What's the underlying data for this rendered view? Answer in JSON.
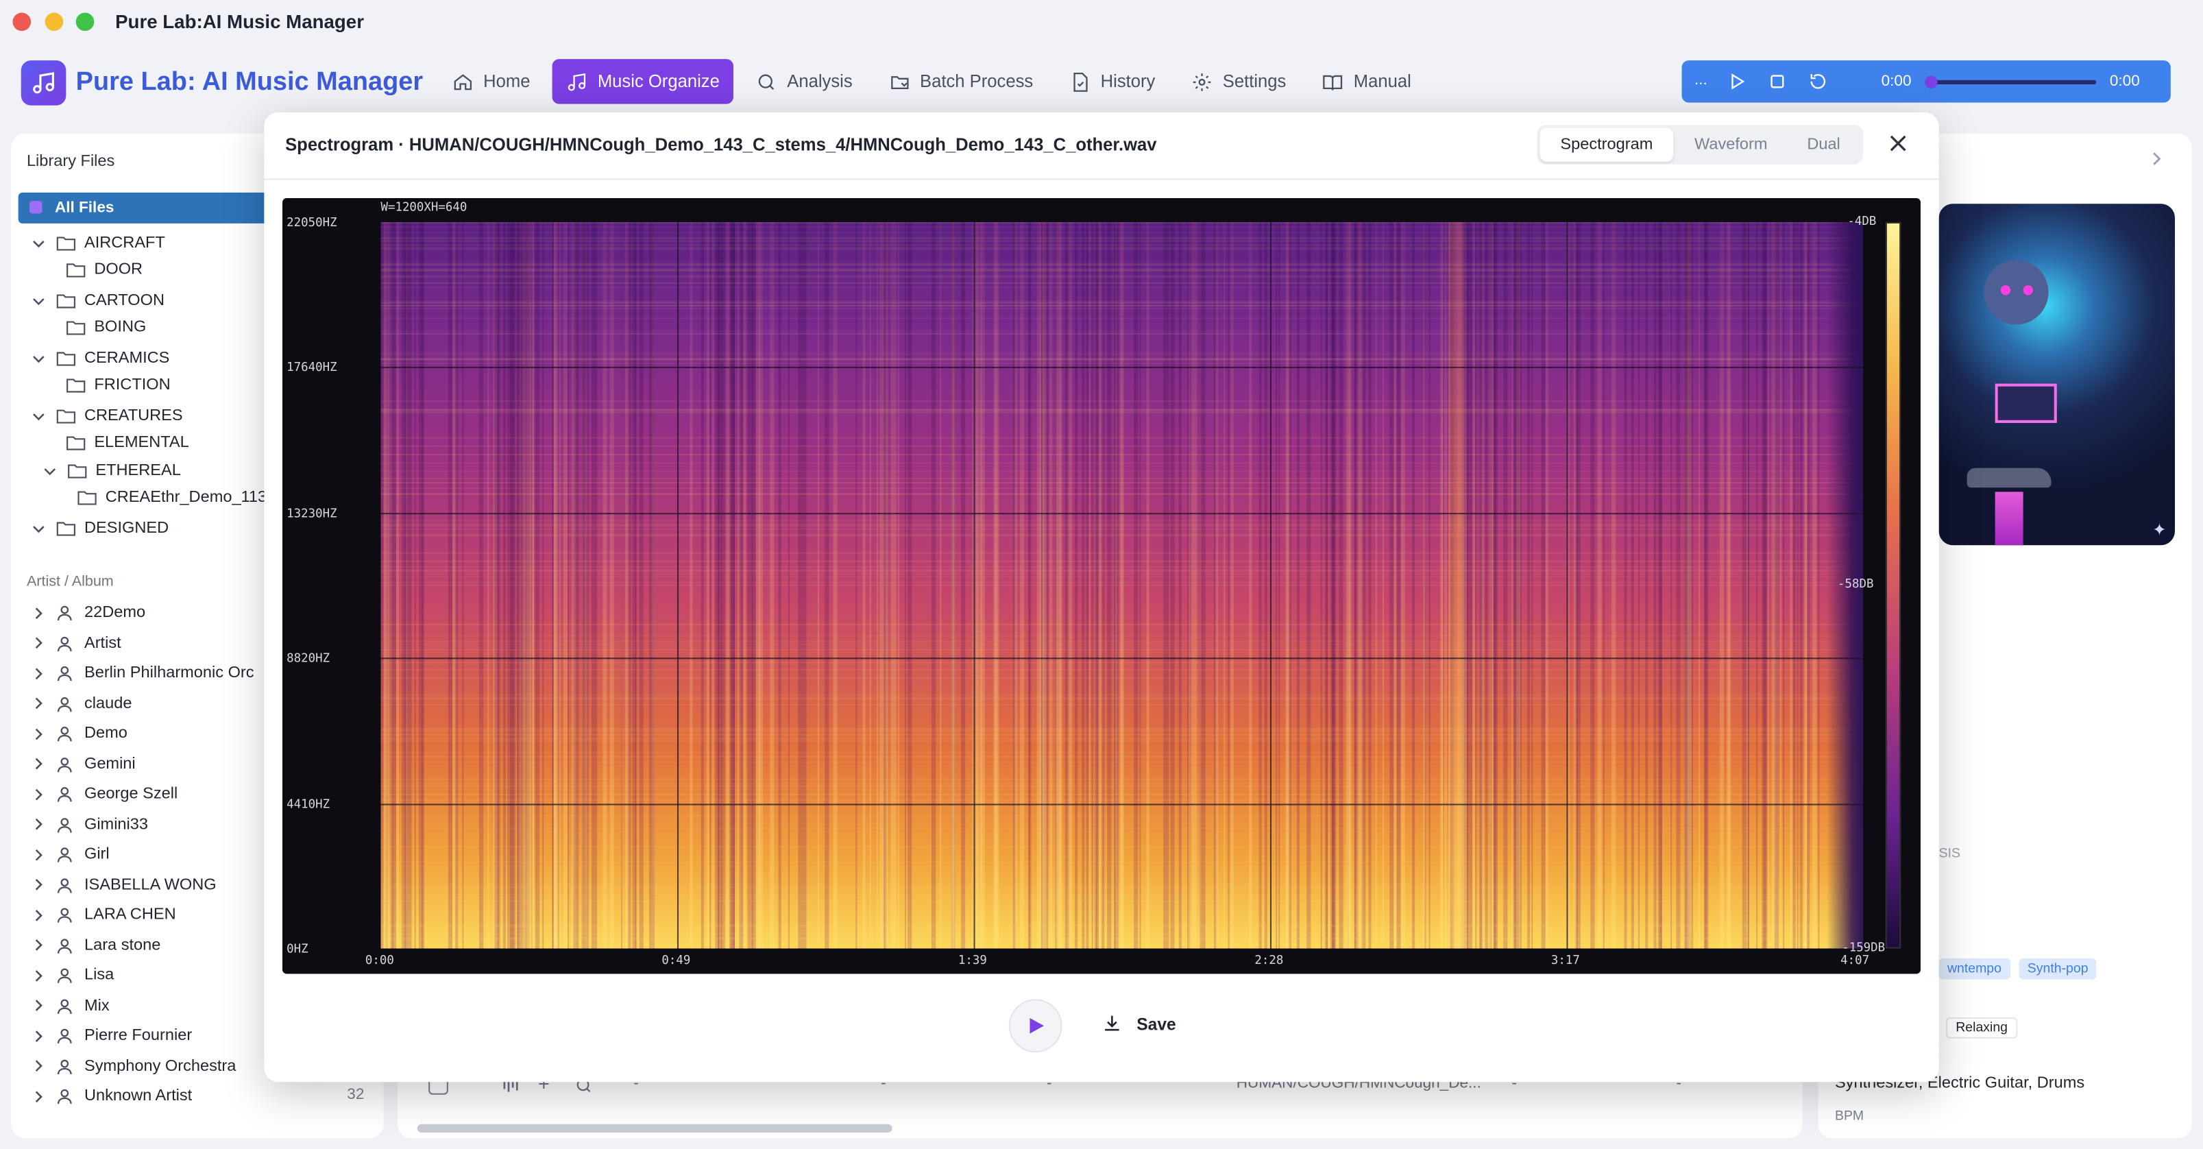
{
  "window": {
    "title": "Pure Lab:AI Music Manager"
  },
  "brand": {
    "name": "Pure Lab: AI Music Manager"
  },
  "nav": [
    {
      "label": "Home",
      "icon": "home-icon"
    },
    {
      "label": "Music Organize",
      "icon": "music-note-icon",
      "active": true
    },
    {
      "label": "Analysis",
      "icon": "search-icon"
    },
    {
      "label": "Batch Process",
      "icon": "batch-folder-icon"
    },
    {
      "label": "History",
      "icon": "history-file-icon"
    },
    {
      "label": "Settings",
      "icon": "gear-icon"
    },
    {
      "label": "Manual",
      "icon": "book-icon"
    }
  ],
  "player": {
    "more": "...",
    "current_time": "0:00",
    "total_time": "0:00",
    "progress": 0
  },
  "sidebar": {
    "library_title": "Library Files",
    "all_files": "All Files",
    "folders": [
      {
        "label": "AIRCRAFT",
        "level": 0,
        "expanded": true
      },
      {
        "label": "DOOR",
        "level": 1
      },
      {
        "label": "CARTOON",
        "level": 0,
        "expanded": true
      },
      {
        "label": "BOING",
        "level": 1
      },
      {
        "label": "CERAMICS",
        "level": 0,
        "expanded": true
      },
      {
        "label": "FRICTION",
        "level": 1
      },
      {
        "label": "CREATURES",
        "level": 0,
        "expanded": true
      },
      {
        "label": "ELEMENTAL",
        "level": 1
      },
      {
        "label": "ETHEREAL",
        "level": 1,
        "expanded": true
      },
      {
        "label": "CREAEthr_Demo_113",
        "level": 2
      },
      {
        "label": "DESIGNED",
        "level": 0,
        "expanded": true
      }
    ],
    "artist_title": "Artist / Album",
    "artists": [
      "22Demo",
      "Artist",
      "Berlin Philharmonic Orc",
      "claude",
      "Demo",
      "Gemini",
      "George Szell",
      "Gimini33",
      "Girl",
      "ISABELLA WONG",
      "LARA CHEN",
      "Lara stone",
      "Lisa",
      "Mix",
      "Pierre Fournier",
      "Symphony Orchestra",
      "Unknown Artist"
    ],
    "count": "32"
  },
  "background": {
    "row": {
      "c1": "-",
      "c2": "-",
      "c3": "-",
      "path": "HUMAN/COUGH/HMNCough_De...",
      "c5": "-",
      "c6": "-"
    }
  },
  "right_panel": {
    "analysis_fragment": "SIS",
    "genres": [
      "wntempo",
      "Synth-pop"
    ],
    "mood": "Relaxing",
    "instruments": "Synthesizer, Electric Guitar, Drums",
    "bpm_label": "BPM"
  },
  "modal": {
    "title": "Spectrogram · HUMAN/COUGH/HMNCough_Demo_143_C_stems_4/HMNCough_Demo_143_C_other.wav",
    "tabs": [
      {
        "label": "Spectrogram",
        "active": true
      },
      {
        "label": "Waveform"
      },
      {
        "label": "Dual"
      }
    ],
    "save_label": "Save"
  },
  "chart_data": {
    "type": "heatmap",
    "title": "",
    "dimensions_label": "W=1200XH=640",
    "y_ticks": [
      "22050HZ",
      "17640HZ",
      "13230HZ",
      "8820HZ",
      "4410HZ",
      "0HZ"
    ],
    "x_ticks": [
      "0:00",
      "0:49",
      "1:39",
      "2:28",
      "3:17",
      "4:07"
    ],
    "ylim": [
      0,
      22050
    ],
    "xlim": [
      "0:00",
      "4:07"
    ],
    "colorbar": {
      "max": "-4DB",
      "mid": "-58DB",
      "min": "-159DB"
    },
    "colormap": [
      "#fcd95a",
      "#f2a53c",
      "#e2703d",
      "#c6466a",
      "#9c3184",
      "#7a2a8c",
      "#5b2183"
    ],
    "grid": true
  }
}
